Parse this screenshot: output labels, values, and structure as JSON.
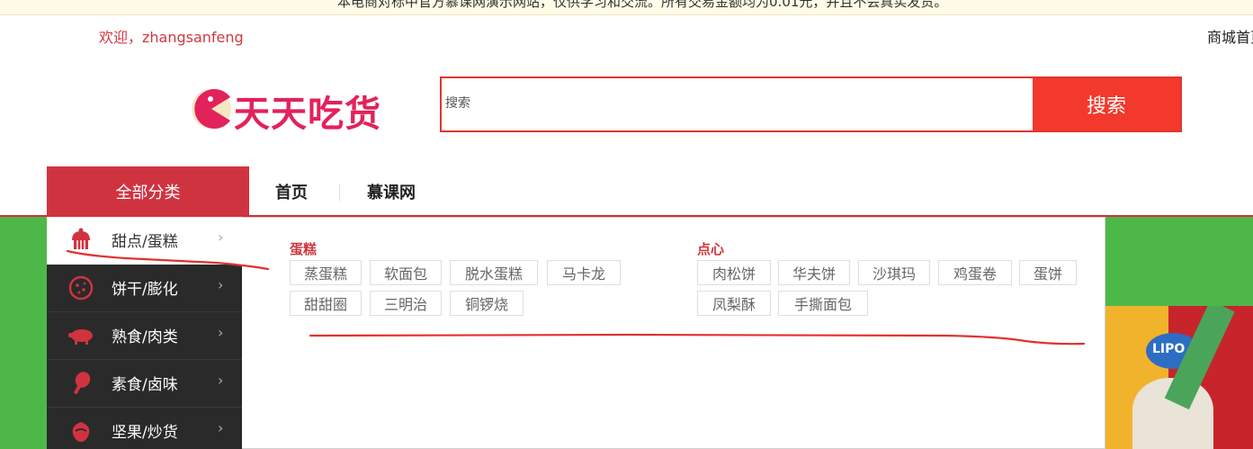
{
  "notice": {
    "text": "本电商对标中官方慕课网演示网站，仅供学习和交流。所有交易金额均为0.01元，并且不会真实发货。"
  },
  "header": {
    "welcome": "欢迎，zhangsanfeng",
    "home_link": "商城首页"
  },
  "logo": {
    "text": "天天吃货"
  },
  "search": {
    "placeholder": "搜索",
    "button_label": "搜索"
  },
  "nav": {
    "all_categories": "全部分类",
    "items": [
      {
        "label": "首页"
      },
      {
        "label": "慕课网"
      }
    ]
  },
  "sidebar": {
    "items": [
      {
        "label": "甜点/蛋糕",
        "icon": "cake-icon"
      },
      {
        "label": "饼干/膨化",
        "icon": "cookie-icon"
      },
      {
        "label": "熟食/肉类",
        "icon": "pig-icon"
      },
      {
        "label": "素食/卤味",
        "icon": "drumstick-icon"
      },
      {
        "label": "坚果/炒货",
        "icon": "nut-icon"
      }
    ]
  },
  "subcategories": {
    "groups": [
      {
        "title": "蛋糕",
        "tags": [
          "蒸蛋糕",
          "软面包",
          "脱水蛋糕",
          "马卡龙",
          "甜甜圈",
          "三明治",
          "铜锣烧"
        ]
      },
      {
        "title": "点心",
        "tags": [
          "肉松饼",
          "华夫饼",
          "沙琪玛",
          "鸡蛋卷",
          "蛋饼",
          "凤梨酥",
          "手撕面包"
        ]
      }
    ]
  },
  "promo": {
    "label": "LIPO"
  },
  "colors": {
    "brand": "#d03340",
    "search_button": "#f2392b",
    "sidebar_bg": "#2a2a2a",
    "banner_green": "#4db848"
  }
}
